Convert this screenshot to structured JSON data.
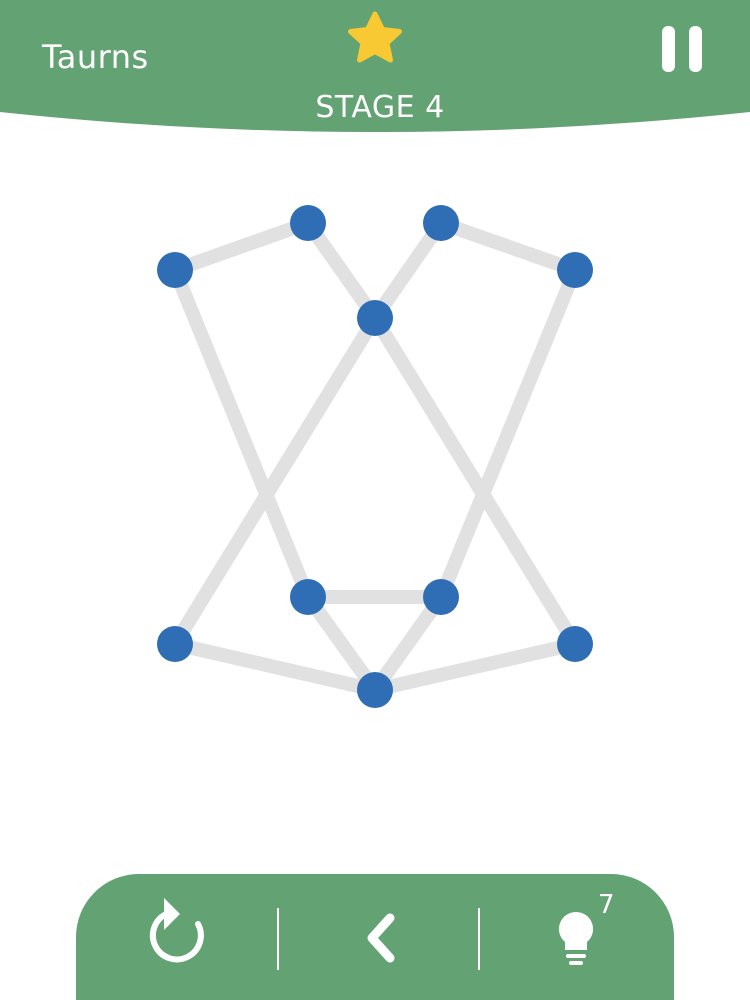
{
  "header": {
    "title": "Taurns",
    "stage": "STAGE 4",
    "star_icon": "star-icon",
    "pause_icon": "pause-icon",
    "colors": {
      "bar": "#63a273",
      "star": "#f8c933",
      "text": "#ffffff"
    }
  },
  "puzzle": {
    "node_color": "#2f6eb5",
    "edge_color": "#e1e1e1",
    "nodes": [
      "n1",
      "n2",
      "n3",
      "n4",
      "n5",
      "n6",
      "n7",
      "n8",
      "n9",
      "n10"
    ],
    "edges_count": 13
  },
  "toolbar": {
    "restart_icon": "restart-icon",
    "back_icon": "chevron-left-icon",
    "hint_icon": "lightbulb-icon",
    "hint_count": "7"
  }
}
